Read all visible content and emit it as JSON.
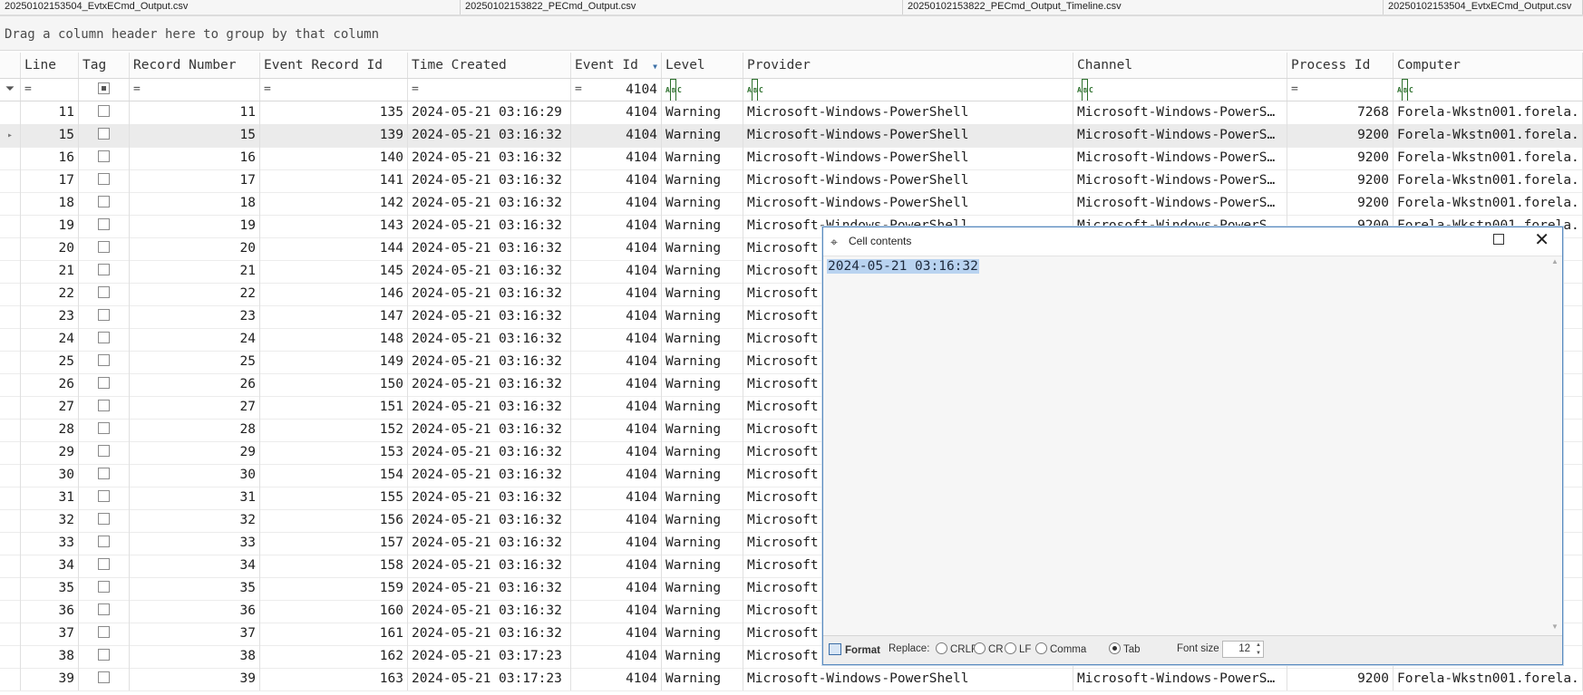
{
  "tabs": [
    "20250102153504_EvtxECmd_Output.csv",
    "20250102153822_PECmd_Output.csv",
    "20250102153822_PECmd_Output_Timeline.csv",
    "20250102153504_EvtxECmd_Output.csv"
  ],
  "group_panel": "Drag a column header here to group by that column",
  "columns": [
    "Line",
    "Tag",
    "Record Number",
    "Event Record Id",
    "Time Created",
    "Event Id",
    "Level",
    "Provider",
    "Channel",
    "Process Id",
    "Computer"
  ],
  "filter_row": {
    "equals_symbol": "=",
    "event_id_filter": "4104",
    "text_filter_icon": "abc-text-filter-icon"
  },
  "rows": [
    {
      "line": "11",
      "record": "11",
      "event_record": "135",
      "time": "2024-05-21 03:16:29",
      "event_id": "4104",
      "level": "Warning",
      "provider": "Microsoft-Windows-PowerShell",
      "channel": "Microsoft-Windows-PowerS…",
      "pid": "7268",
      "computer": "Forela-Wkstn001.forela."
    },
    {
      "line": "15",
      "record": "15",
      "event_record": "139",
      "time": "2024-05-21 03:16:32",
      "event_id": "4104",
      "level": "Warning",
      "provider": "Microsoft-Windows-PowerShell",
      "channel": "Microsoft-Windows-PowerS…",
      "pid": "9200",
      "computer": "Forela-Wkstn001.forela."
    },
    {
      "line": "16",
      "record": "16",
      "event_record": "140",
      "time": "2024-05-21 03:16:32",
      "event_id": "4104",
      "level": "Warning",
      "provider": "Microsoft-Windows-PowerShell",
      "channel": "Microsoft-Windows-PowerS…",
      "pid": "9200",
      "computer": "Forela-Wkstn001.forela."
    },
    {
      "line": "17",
      "record": "17",
      "event_record": "141",
      "time": "2024-05-21 03:16:32",
      "event_id": "4104",
      "level": "Warning",
      "provider": "Microsoft-Windows-PowerShell",
      "channel": "Microsoft-Windows-PowerS…",
      "pid": "9200",
      "computer": "Forela-Wkstn001.forela."
    },
    {
      "line": "18",
      "record": "18",
      "event_record": "142",
      "time": "2024-05-21 03:16:32",
      "event_id": "4104",
      "level": "Warning",
      "provider": "Microsoft-Windows-PowerShell",
      "channel": "Microsoft-Windows-PowerS…",
      "pid": "9200",
      "computer": "Forela-Wkstn001.forela."
    },
    {
      "line": "19",
      "record": "19",
      "event_record": "143",
      "time": "2024-05-21 03:16:32",
      "event_id": "4104",
      "level": "Warning",
      "provider": "Microsoft-Windows-PowerShell",
      "channel": "Microsoft-Windows-PowerS…",
      "pid": "9200",
      "computer": "Forela-Wkstn001.forela."
    },
    {
      "line": "20",
      "record": "20",
      "event_record": "144",
      "time": "2024-05-21 03:16:32",
      "event_id": "4104",
      "level": "Warning",
      "provider": "Microsoft",
      "channel": "",
      "pid": "",
      "computer": "a."
    },
    {
      "line": "21",
      "record": "21",
      "event_record": "145",
      "time": "2024-05-21 03:16:32",
      "event_id": "4104",
      "level": "Warning",
      "provider": "Microsoft",
      "channel": "",
      "pid": "",
      "computer": "a."
    },
    {
      "line": "22",
      "record": "22",
      "event_record": "146",
      "time": "2024-05-21 03:16:32",
      "event_id": "4104",
      "level": "Warning",
      "provider": "Microsoft",
      "channel": "",
      "pid": "",
      "computer": "a."
    },
    {
      "line": "23",
      "record": "23",
      "event_record": "147",
      "time": "2024-05-21 03:16:32",
      "event_id": "4104",
      "level": "Warning",
      "provider": "Microsoft",
      "channel": "",
      "pid": "",
      "computer": "a."
    },
    {
      "line": "24",
      "record": "24",
      "event_record": "148",
      "time": "2024-05-21 03:16:32",
      "event_id": "4104",
      "level": "Warning",
      "provider": "Microsoft",
      "channel": "",
      "pid": "",
      "computer": "a."
    },
    {
      "line": "25",
      "record": "25",
      "event_record": "149",
      "time": "2024-05-21 03:16:32",
      "event_id": "4104",
      "level": "Warning",
      "provider": "Microsoft",
      "channel": "",
      "pid": "",
      "computer": "a."
    },
    {
      "line": "26",
      "record": "26",
      "event_record": "150",
      "time": "2024-05-21 03:16:32",
      "event_id": "4104",
      "level": "Warning",
      "provider": "Microsoft",
      "channel": "",
      "pid": "",
      "computer": "a."
    },
    {
      "line": "27",
      "record": "27",
      "event_record": "151",
      "time": "2024-05-21 03:16:32",
      "event_id": "4104",
      "level": "Warning",
      "provider": "Microsoft",
      "channel": "",
      "pid": "",
      "computer": "a."
    },
    {
      "line": "28",
      "record": "28",
      "event_record": "152",
      "time": "2024-05-21 03:16:32",
      "event_id": "4104",
      "level": "Warning",
      "provider": "Microsoft",
      "channel": "",
      "pid": "",
      "computer": "a."
    },
    {
      "line": "29",
      "record": "29",
      "event_record": "153",
      "time": "2024-05-21 03:16:32",
      "event_id": "4104",
      "level": "Warning",
      "provider": "Microsoft",
      "channel": "",
      "pid": "",
      "computer": "a."
    },
    {
      "line": "30",
      "record": "30",
      "event_record": "154",
      "time": "2024-05-21 03:16:32",
      "event_id": "4104",
      "level": "Warning",
      "provider": "Microsoft",
      "channel": "",
      "pid": "",
      "computer": "a."
    },
    {
      "line": "31",
      "record": "31",
      "event_record": "155",
      "time": "2024-05-21 03:16:32",
      "event_id": "4104",
      "level": "Warning",
      "provider": "Microsoft",
      "channel": "",
      "pid": "",
      "computer": "a."
    },
    {
      "line": "32",
      "record": "32",
      "event_record": "156",
      "time": "2024-05-21 03:16:32",
      "event_id": "4104",
      "level": "Warning",
      "provider": "Microsoft",
      "channel": "",
      "pid": "",
      "computer": "a."
    },
    {
      "line": "33",
      "record": "33",
      "event_record": "157",
      "time": "2024-05-21 03:16:32",
      "event_id": "4104",
      "level": "Warning",
      "provider": "Microsoft",
      "channel": "",
      "pid": "",
      "computer": "a."
    },
    {
      "line": "34",
      "record": "34",
      "event_record": "158",
      "time": "2024-05-21 03:16:32",
      "event_id": "4104",
      "level": "Warning",
      "provider": "Microsoft",
      "channel": "",
      "pid": "",
      "computer": "a."
    },
    {
      "line": "35",
      "record": "35",
      "event_record": "159",
      "time": "2024-05-21 03:16:32",
      "event_id": "4104",
      "level": "Warning",
      "provider": "Microsoft",
      "channel": "",
      "pid": "",
      "computer": "a."
    },
    {
      "line": "36",
      "record": "36",
      "event_record": "160",
      "time": "2024-05-21 03:16:32",
      "event_id": "4104",
      "level": "Warning",
      "provider": "Microsoft",
      "channel": "",
      "pid": "",
      "computer": "a."
    },
    {
      "line": "37",
      "record": "37",
      "event_record": "161",
      "time": "2024-05-21 03:16:32",
      "event_id": "4104",
      "level": "Warning",
      "provider": "Microsoft",
      "channel": "",
      "pid": "",
      "computer": "a."
    },
    {
      "line": "38",
      "record": "38",
      "event_record": "162",
      "time": "2024-05-21 03:17:23",
      "event_id": "4104",
      "level": "Warning",
      "provider": "Microsoft",
      "channel": "",
      "pid": "",
      "computer": "a."
    },
    {
      "line": "39",
      "record": "39",
      "event_record": "163",
      "time": "2024-05-21 03:17:23",
      "event_id": "4104",
      "level": "Warning",
      "provider": "Microsoft-Windows-PowerShell",
      "channel": "Microsoft-Windows-PowerS…",
      "pid": "9200",
      "computer": "Forela-Wkstn001.forela."
    }
  ],
  "selected_row_index": 1,
  "dialog": {
    "title": "Cell contents",
    "content": "2024-05-21 03:16:32",
    "format_label": "Format",
    "replace_label": "Replace:",
    "options": [
      "CRLF",
      "CR",
      "LF",
      "Comma",
      "Tab"
    ],
    "selected_option": "Tab",
    "font_size_label": "Font size",
    "font_size_value": "12"
  },
  "colors": {
    "selection": "#b9d3f0",
    "dialog_border": "#5a8bbf",
    "selected_row": "#ebebeb"
  }
}
